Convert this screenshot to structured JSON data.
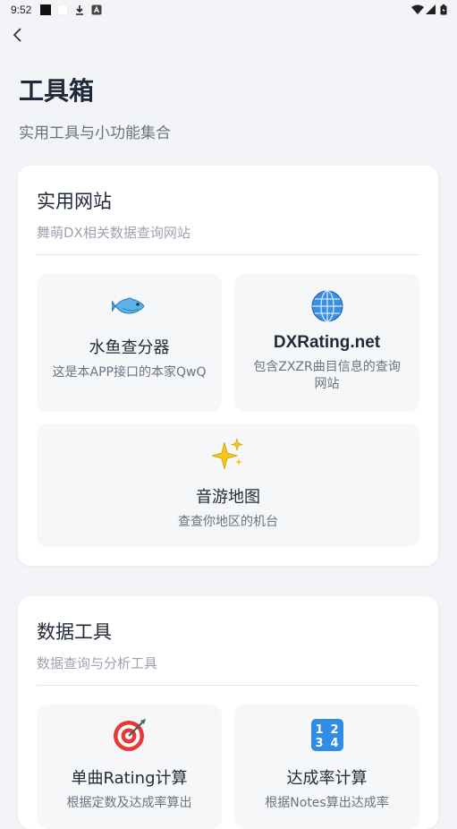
{
  "status_bar": {
    "time": "9:52"
  },
  "header": {
    "title": "工具箱",
    "subtitle": "实用工具与小功能集合"
  },
  "sections": [
    {
      "title": "实用网站",
      "subtitle": "舞萌DX相关数据查询网站",
      "items": [
        {
          "icon": "fish-icon",
          "name": "水鱼查分器",
          "desc": "这是本APP接口的本家QwQ"
        },
        {
          "icon": "globe-icon",
          "name": "DXRating.net",
          "desc": "包含ZXZR曲目信息的查询网站"
        },
        {
          "icon": "sparkles-icon",
          "name": "音游地图",
          "desc": "查查你地区的机台"
        }
      ]
    },
    {
      "title": "数据工具",
      "subtitle": "数据查询与分析工具",
      "items": [
        {
          "icon": "target-icon",
          "name": "单曲Rating计算",
          "desc": "根据定数及达成率算出"
        },
        {
          "icon": "numbers-1234-icon",
          "name": "达成率计算",
          "desc": "根据Notes算出达成率"
        }
      ]
    }
  ]
}
